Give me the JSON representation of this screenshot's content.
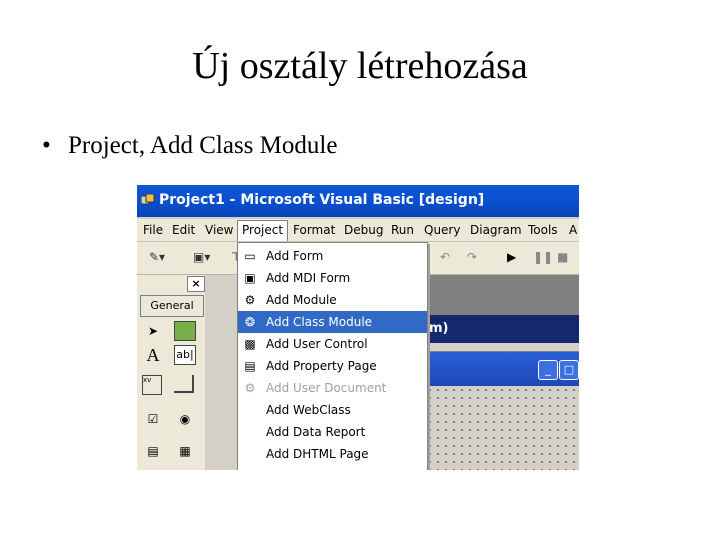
{
  "slide": {
    "title": "Új osztály létrehozása",
    "bullet_text": "Project, Add Class Module"
  },
  "window": {
    "title": "Project1 - Microsoft Visual Basic [design]"
  },
  "menubar": [
    "File",
    "Edit",
    "View",
    "Project",
    "Format",
    "Debug",
    "Run",
    "Query",
    "Diagram",
    "Tools",
    "A"
  ],
  "toolbox": {
    "close_label": "×",
    "tab_label": "General",
    "label_tool": "A",
    "textbox_tool": "ab|",
    "frame_tool": "xv"
  },
  "form_window": {
    "caption_fragment": "m)"
  },
  "project_menu": {
    "items": [
      {
        "label": "Add Form",
        "icon": "form-icon",
        "state": "normal"
      },
      {
        "label": "Add MDI Form",
        "icon": "mdi-form-icon",
        "state": "normal"
      },
      {
        "label": "Add Module",
        "icon": "module-icon",
        "state": "normal"
      },
      {
        "label": "Add Class Module",
        "icon": "class-module-icon",
        "state": "selected"
      },
      {
        "label": "Add User Control",
        "icon": "user-control-icon",
        "state": "normal"
      },
      {
        "label": "Add Property Page",
        "icon": "property-page-icon",
        "state": "normal"
      },
      {
        "label": "Add User Document",
        "icon": "user-document-icon",
        "state": "disabled"
      },
      {
        "label": "Add WebClass",
        "icon": "",
        "state": "normal"
      },
      {
        "label": "Add Data Report",
        "icon": "",
        "state": "normal"
      },
      {
        "label": "Add DHTML Page",
        "icon": "",
        "state": "normal"
      }
    ]
  },
  "colors": {
    "titlebar": "#0a58d4",
    "menu_highlight": "#316ac5",
    "form_caption": "#14286e"
  }
}
